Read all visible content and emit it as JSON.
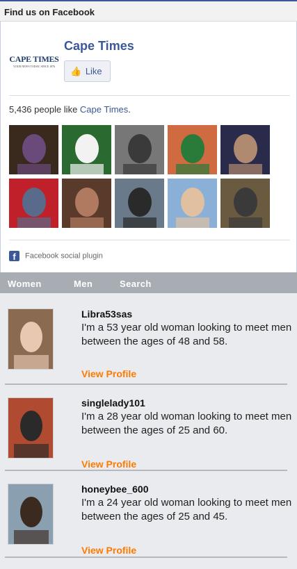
{
  "facebook_box": {
    "header": "Find us on Facebook",
    "page_name": "Cape Times",
    "logo_text": "CAPE TIMES",
    "logo_tagline": "YOUR NEWS TODAY, SINCE 1876",
    "like_label": "Like",
    "likes_prefix": "5,436 people like ",
    "likes_link": "Cape Times",
    "likes_suffix": ".",
    "plugin_label": "Facebook social plugin",
    "faces": [
      {
        "name": "face-1",
        "colors": [
          "#3a2a1e",
          "#6a4a7a"
        ]
      },
      {
        "name": "face-2",
        "colors": [
          "#2a6a30",
          "#f2f2f2"
        ]
      },
      {
        "name": "face-3",
        "colors": [
          "#777777",
          "#3a3a3a"
        ]
      },
      {
        "name": "face-4",
        "colors": [
          "#d06a40",
          "#2a7a3a"
        ]
      },
      {
        "name": "face-5",
        "colors": [
          "#2a2a4a",
          "#b08a70"
        ]
      },
      {
        "name": "face-6",
        "colors": [
          "#c0202a",
          "#5a6a8a"
        ]
      },
      {
        "name": "face-7",
        "colors": [
          "#5a3a2a",
          "#b07a60"
        ]
      },
      {
        "name": "face-8",
        "colors": [
          "#6a7a8a",
          "#2a2a2a"
        ]
      },
      {
        "name": "face-9",
        "colors": [
          "#8ab0d8",
          "#e0c0a0"
        ]
      },
      {
        "name": "face-10",
        "colors": [
          "#6a5a40",
          "#3a3a3a"
        ]
      }
    ]
  },
  "nav": {
    "items": [
      "Women",
      "Men",
      "Search"
    ]
  },
  "profiles": [
    {
      "username": "Libra53sas",
      "description": "I'm a 53 year old woman looking to meet men between the ages of 48 and 58.",
      "link": "View Profile",
      "photo_colors": [
        "#8a6a50",
        "#e8c8b0"
      ]
    },
    {
      "username": "singlelady101",
      "description": "I'm a 28 year old woman looking to meet men between the ages of 25 and 60.",
      "link": "View Profile",
      "photo_colors": [
        "#b04a30",
        "#2a2a2a"
      ]
    },
    {
      "username": "honeybee_600",
      "description": "I'm a 24 year old woman looking to meet men between the ages of 25 and 45.",
      "link": "View Profile",
      "photo_colors": [
        "#8aa0b0",
        "#3a2a20"
      ]
    }
  ],
  "colors": {
    "facebook_blue": "#3b5998",
    "link_orange": "#ff7a00",
    "nav_gray": "#a8adb3",
    "profile_bg": "#e9ebee"
  }
}
